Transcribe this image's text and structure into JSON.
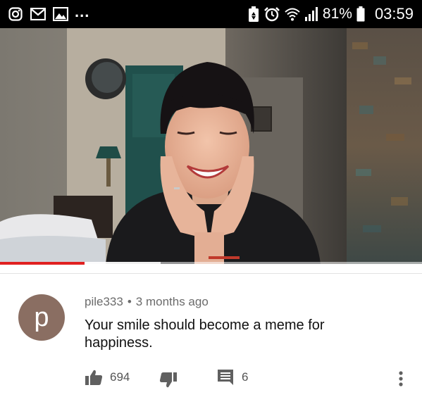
{
  "status_bar": {
    "left_icons": [
      "instagram-icon",
      "mail-icon",
      "image-icon"
    ],
    "overflow": "...",
    "right_icons": [
      "battery-saver-icon",
      "alarm-icon",
      "wifi-icon",
      "signal-icon",
      "battery-icon"
    ],
    "battery_percent": "81%",
    "time": "03:59"
  },
  "video": {
    "progress_fraction": 0.2,
    "buffer_fraction": 0.38,
    "progress_color": "#e02020"
  },
  "comment": {
    "avatar_letter": "p",
    "avatar_color": "#8a6e62",
    "username": "pile333",
    "separator": "•",
    "timestamp": "3 months ago",
    "text": "Your smile should become a meme for happiness."
  },
  "actions": {
    "like_count": "694",
    "reply_count": "6"
  }
}
